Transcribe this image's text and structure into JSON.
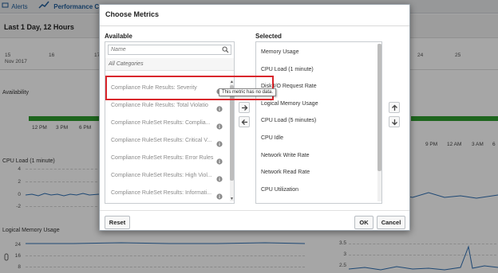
{
  "background": {
    "tabs": [
      {
        "label": "Alerts"
      },
      {
        "label": "Performance Ch"
      }
    ],
    "range": "Last 1 Day, 12 Hours",
    "date_ticks": [
      "15",
      "16",
      "17",
      "24",
      "25"
    ],
    "date_sub": "Nov 2017",
    "sections": {
      "availability": "Availability",
      "cpu_load": "CPU Load (1 minute)",
      "logical_memory": "Logical Memory Usage"
    },
    "hour_ticks_left": [
      "12 PM",
      "3 PM",
      "6 PM"
    ],
    "hour_ticks_right": [
      "9 PM",
      "12 AM",
      "3 AM",
      "6"
    ],
    "cpu_y": [
      "4",
      "2",
      "0",
      "-2"
    ],
    "mem_y": [
      "24",
      "16",
      "8"
    ],
    "right_y_top": [
      "3.5",
      "3",
      "2.5"
    ],
    "right_y_bottom": [
      "3.5",
      "3",
      "2.5"
    ]
  },
  "dialog": {
    "title": "Choose Metrics",
    "available_label": "Available",
    "selected_label": "Selected",
    "search": {
      "placeholder": "Name"
    },
    "all_categories": "All Categories",
    "available_items": [
      {
        "label": "Compliance Rule Results: Severity"
      },
      {
        "label": "Compliance Rule Results: Total Violatio"
      },
      {
        "label": "Compliance RuleSet Results: Complia..."
      },
      {
        "label": "Compliance RuleSet Results: Critical V..."
      },
      {
        "label": "Compliance RuleSet Results: Error Rules"
      },
      {
        "label": "Compliance RuleSet Results: High Viol..."
      },
      {
        "label": "Compliance RuleSet Results: Informati..."
      }
    ],
    "selected_items": [
      {
        "label": "Memory Usage"
      },
      {
        "label": "CPU Load (1 minute)"
      },
      {
        "label": "Disk I/O Request Rate"
      },
      {
        "label": "Logical Memory Usage"
      },
      {
        "label": "CPU Load (5 minutes)"
      },
      {
        "label": "CPU Idle"
      },
      {
        "label": "Network Write Rate"
      },
      {
        "label": "Network Read Rate"
      },
      {
        "label": "CPU Utilization"
      }
    ],
    "tooltip": "This metric has no data.",
    "buttons": {
      "reset": "Reset",
      "ok": "OK",
      "cancel": "Cancel"
    },
    "icons": {
      "move_right": "arrow-right-icon",
      "move_left": "arrow-left-icon",
      "move_up": "arrow-up-icon",
      "move_down": "arrow-down-icon",
      "info": "info-icon",
      "search": "search-icon"
    },
    "highlight_color": "#d9262c"
  }
}
